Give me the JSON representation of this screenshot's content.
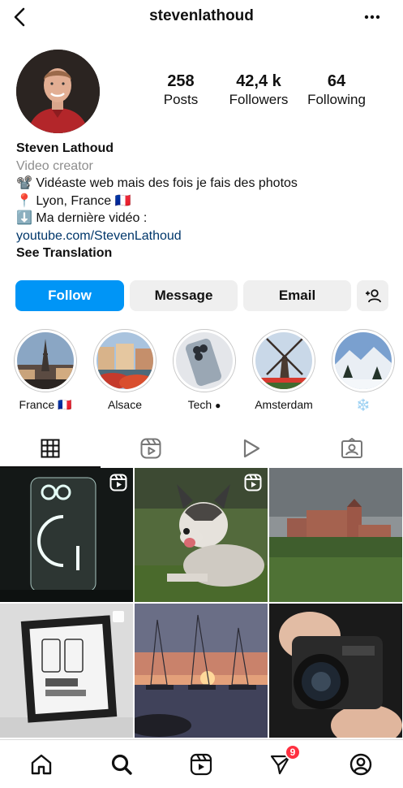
{
  "header": {
    "username": "stevenlathoud"
  },
  "profile": {
    "stats": [
      {
        "value": "258",
        "label": "Posts"
      },
      {
        "value": "42,4 k",
        "label": "Followers"
      },
      {
        "value": "64",
        "label": "Following"
      }
    ],
    "name": "Steven Lathoud",
    "category": "Video creator",
    "bio_line1": "📽️ Vidéaste web mais des fois je fais des photos",
    "bio_line2": "📍 Lyon, France 🇫🇷",
    "bio_line3": "⬇️ Ma dernière vidéo :",
    "link": "youtube.com/StevenLathoud",
    "see_translation": "See Translation"
  },
  "actions": {
    "follow": "Follow",
    "message": "Message",
    "email": "Email"
  },
  "highlights": [
    {
      "label": "France 🇫🇷"
    },
    {
      "label": "Alsace"
    },
    {
      "label": "Tech "
    },
    {
      "label": "Amsterdam"
    },
    {
      "label": "❄️"
    }
  ],
  "tabs": [
    "posts-grid-icon",
    "reels-icon",
    "videos-play-icon",
    "tagged-icon"
  ],
  "nav": {
    "notifications_count": "9"
  }
}
